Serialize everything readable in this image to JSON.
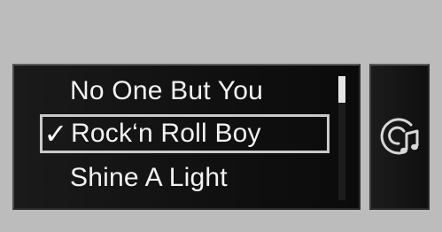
{
  "song_list": {
    "items": [
      {
        "label": "No One But You",
        "checked": false,
        "selected": false
      },
      {
        "label": "Rock‘n Roll Boy",
        "checked": true,
        "selected": true
      },
      {
        "label": "Shine A Light",
        "checked": false,
        "selected": false
      }
    ],
    "check_mark": "✓",
    "scroll_position": 0.0
  },
  "side_button": {
    "icon": "cd-music-icon"
  },
  "colors": {
    "background": "#bcbcbc",
    "screen": "#121212",
    "text": "#f2f2f2",
    "selection_border": "#c9c9c9"
  }
}
